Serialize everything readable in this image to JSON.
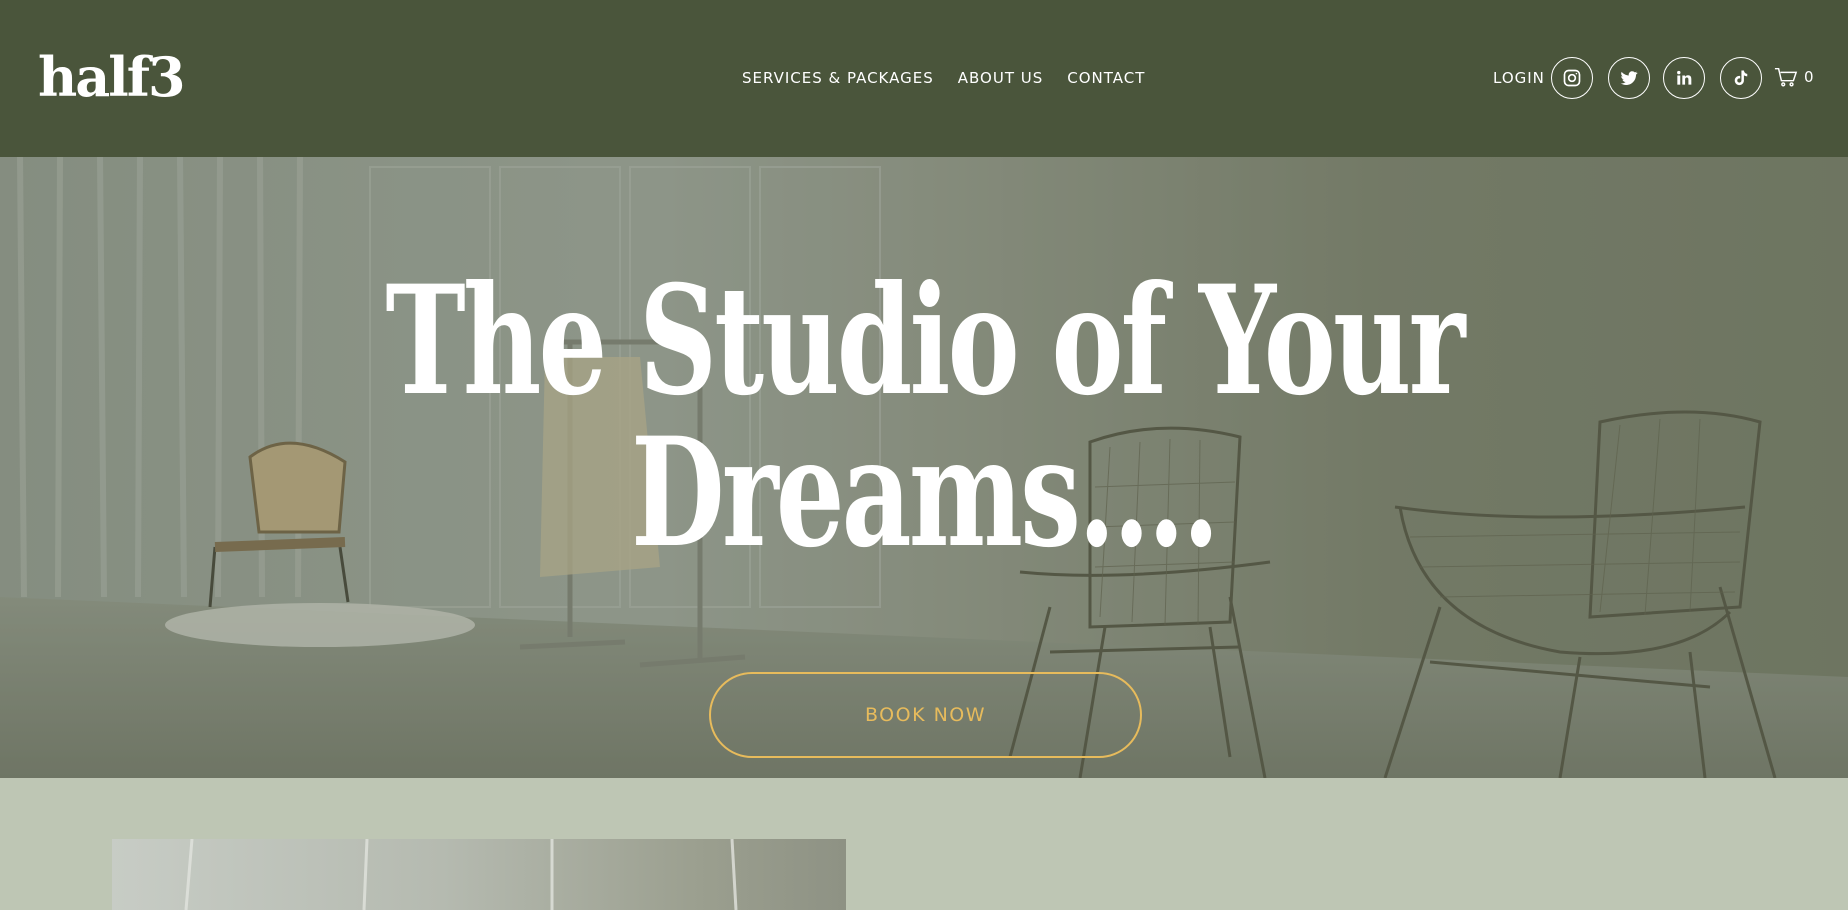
{
  "header": {
    "logo_text": "half3",
    "nav": [
      {
        "label": "SERVICES & PACKAGES"
      },
      {
        "label": "ABOUT US"
      },
      {
        "label": "CONTACT"
      }
    ],
    "login_label": "LOGIN",
    "social_icons": [
      "instagram-icon",
      "twitter-icon",
      "linkedin-icon",
      "tiktok-icon"
    ],
    "cart_count": "0"
  },
  "hero": {
    "title_line1": "The Studio of Your",
    "title_line2": "Dreams....",
    "button_label": "BOOK NOW"
  },
  "colors": {
    "header_bg": "#4a553b",
    "accent": "#e7bb5c",
    "section_bg": "#bec6b4",
    "text_on_dark": "#ffffff"
  }
}
